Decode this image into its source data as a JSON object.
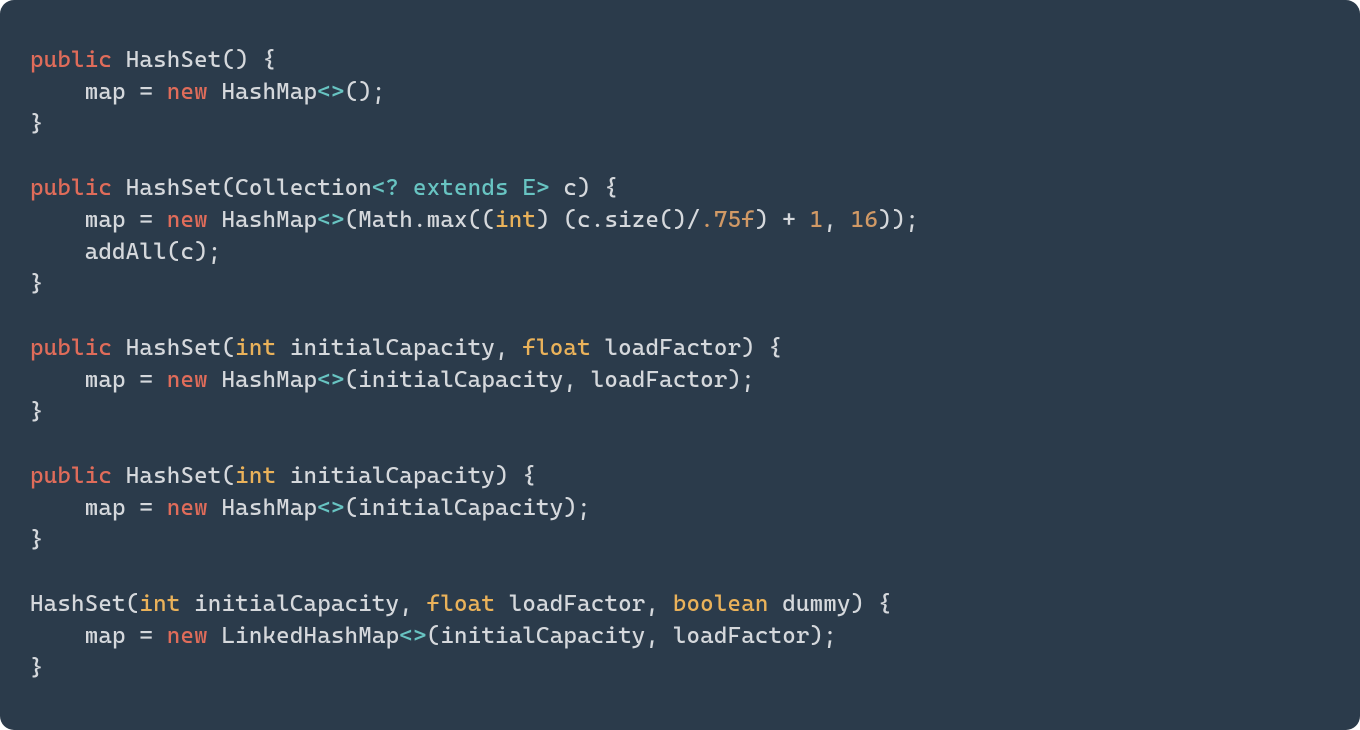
{
  "colors": {
    "background": "#2b3b4b",
    "foreground": "#d5d8dc",
    "keyword": "#e06c5a",
    "type": "#eab25a",
    "generic": "#68c4c2",
    "number": "#d19965"
  },
  "code": {
    "language": "java",
    "lines": [
      [
        {
          "t": "kw",
          "v": "public"
        },
        {
          "t": "pn",
          "v": " HashSet() {"
        }
      ],
      [
        {
          "t": "pn",
          "v": "    map = "
        },
        {
          "t": "kw",
          "v": "new"
        },
        {
          "t": "pn",
          "v": " HashMap"
        },
        {
          "t": "gen",
          "v": "<>"
        },
        {
          "t": "pn",
          "v": "();"
        }
      ],
      [
        {
          "t": "pn",
          "v": "}"
        }
      ],
      [
        {
          "t": "pn",
          "v": ""
        }
      ],
      [
        {
          "t": "kw",
          "v": "public"
        },
        {
          "t": "pn",
          "v": " HashSet(Collection"
        },
        {
          "t": "gen",
          "v": "<? extends E>"
        },
        {
          "t": "pn",
          "v": " c) {"
        }
      ],
      [
        {
          "t": "pn",
          "v": "    map = "
        },
        {
          "t": "kw",
          "v": "new"
        },
        {
          "t": "pn",
          "v": " HashMap"
        },
        {
          "t": "gen",
          "v": "<>"
        },
        {
          "t": "pn",
          "v": "(Math.max(("
        },
        {
          "t": "type",
          "v": "int"
        },
        {
          "t": "pn",
          "v": ") (c.size()/"
        },
        {
          "t": "num",
          "v": ".75f"
        },
        {
          "t": "pn",
          "v": ") + "
        },
        {
          "t": "num",
          "v": "1"
        },
        {
          "t": "pn",
          "v": ", "
        },
        {
          "t": "num",
          "v": "16"
        },
        {
          "t": "pn",
          "v": "));"
        }
      ],
      [
        {
          "t": "pn",
          "v": "    addAll(c);"
        }
      ],
      [
        {
          "t": "pn",
          "v": "}"
        }
      ],
      [
        {
          "t": "pn",
          "v": ""
        }
      ],
      [
        {
          "t": "kw",
          "v": "public"
        },
        {
          "t": "pn",
          "v": " HashSet("
        },
        {
          "t": "type",
          "v": "int"
        },
        {
          "t": "pn",
          "v": " initialCapacity, "
        },
        {
          "t": "type",
          "v": "float"
        },
        {
          "t": "pn",
          "v": " loadFactor) {"
        }
      ],
      [
        {
          "t": "pn",
          "v": "    map = "
        },
        {
          "t": "kw",
          "v": "new"
        },
        {
          "t": "pn",
          "v": " HashMap"
        },
        {
          "t": "gen",
          "v": "<>"
        },
        {
          "t": "pn",
          "v": "(initialCapacity, loadFactor);"
        }
      ],
      [
        {
          "t": "pn",
          "v": "}"
        }
      ],
      [
        {
          "t": "pn",
          "v": ""
        }
      ],
      [
        {
          "t": "kw",
          "v": "public"
        },
        {
          "t": "pn",
          "v": " HashSet("
        },
        {
          "t": "type",
          "v": "int"
        },
        {
          "t": "pn",
          "v": " initialCapacity) {"
        }
      ],
      [
        {
          "t": "pn",
          "v": "    map = "
        },
        {
          "t": "kw",
          "v": "new"
        },
        {
          "t": "pn",
          "v": " HashMap"
        },
        {
          "t": "gen",
          "v": "<>"
        },
        {
          "t": "pn",
          "v": "(initialCapacity);"
        }
      ],
      [
        {
          "t": "pn",
          "v": "}"
        }
      ],
      [
        {
          "t": "pn",
          "v": ""
        }
      ],
      [
        {
          "t": "pn",
          "v": "HashSet("
        },
        {
          "t": "type",
          "v": "int"
        },
        {
          "t": "pn",
          "v": " initialCapacity, "
        },
        {
          "t": "type",
          "v": "float"
        },
        {
          "t": "pn",
          "v": " loadFactor, "
        },
        {
          "t": "type",
          "v": "boolean"
        },
        {
          "t": "pn",
          "v": " dummy) {"
        }
      ],
      [
        {
          "t": "pn",
          "v": "    map = "
        },
        {
          "t": "kw",
          "v": "new"
        },
        {
          "t": "pn",
          "v": " LinkedHashMap"
        },
        {
          "t": "gen",
          "v": "<>"
        },
        {
          "t": "pn",
          "v": "(initialCapacity, loadFactor);"
        }
      ],
      [
        {
          "t": "pn",
          "v": "}"
        }
      ]
    ]
  }
}
